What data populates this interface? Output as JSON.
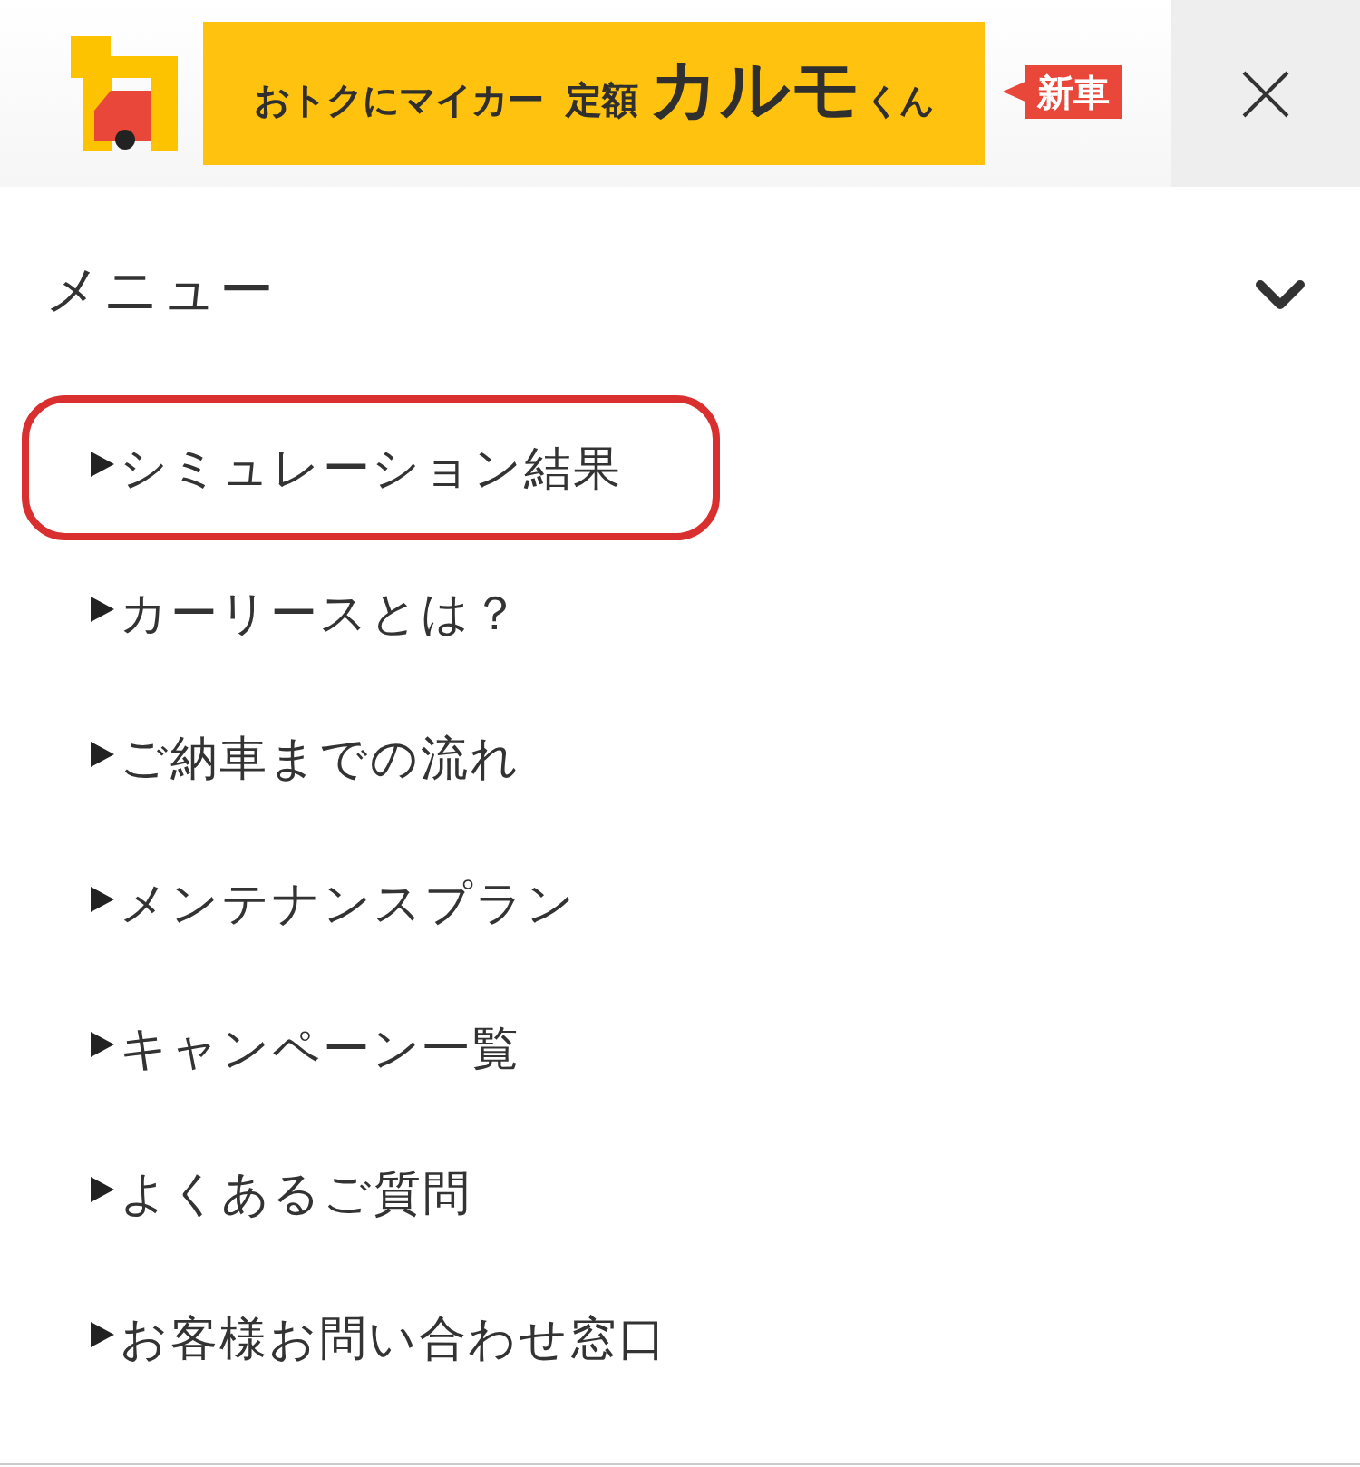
{
  "header": {
    "banner": {
      "tagline": "おトクにマイカー",
      "plan": "定額",
      "brand": "カルモ",
      "suffix": "くん"
    },
    "badge": "新車"
  },
  "menu": {
    "title": "メニュー",
    "expanded": true,
    "items": [
      {
        "label": "シミュレーション結果",
        "selected": true
      },
      {
        "label": "カーリースとは？",
        "selected": false
      },
      {
        "label": "ご納車までの流れ",
        "selected": false
      },
      {
        "label": "メンテナンスプラン",
        "selected": false
      },
      {
        "label": "キャンペーン一覧",
        "selected": false
      },
      {
        "label": "よくあるご質問",
        "selected": false
      },
      {
        "label": "お客様お問い合わせ窓口",
        "selected": false
      }
    ]
  }
}
